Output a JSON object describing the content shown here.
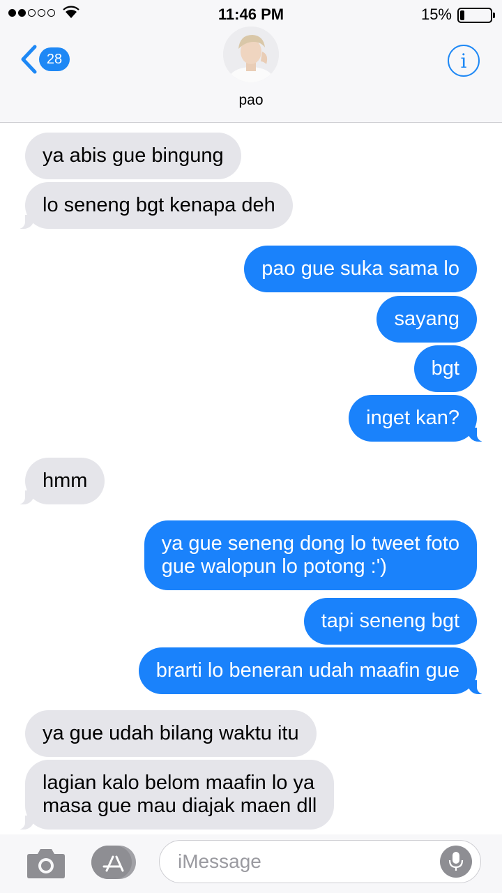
{
  "status_bar": {
    "time": "11:46 PM",
    "battery_percent": "15%",
    "battery_level": 0.15,
    "signal_bars": 2,
    "signal_total": 5
  },
  "header": {
    "back_count": "28",
    "contact_name": "pao",
    "info_icon": "info-icon",
    "accent_color": "#1e88f5"
  },
  "messages": [
    {
      "side": "in",
      "text": "ya abis gue bingung"
    },
    {
      "side": "in",
      "text": "lo seneng bgt kenapa deh"
    },
    {
      "side": "out",
      "text": "pao gue suka sama lo"
    },
    {
      "side": "out",
      "text": "sayang"
    },
    {
      "side": "out",
      "text": "bgt"
    },
    {
      "side": "out",
      "text": "inget kan?"
    },
    {
      "side": "in",
      "text": "hmm"
    },
    {
      "side": "out",
      "lines": [
        "ya gue seneng dong lo tweet foto",
        "gue walopun lo potong :')"
      ]
    },
    {
      "side": "out",
      "text": "tapi seneng bgt"
    },
    {
      "side": "out",
      "text": "brarti lo beneran udah maafin gue"
    },
    {
      "side": "in",
      "text": "ya gue udah bilang waktu itu"
    },
    {
      "side": "in",
      "lines": [
        "lagian kalo belom maafin lo ya",
        "masa gue mau diajak maen dll"
      ]
    }
  ],
  "input_bar": {
    "placeholder": "iMessage",
    "camera_icon": "camera-icon",
    "appstore_icon": "app-store-icon",
    "mic_icon": "microphone-icon"
  },
  "colors": {
    "outgoing_bubble": "#1a82fb",
    "incoming_bubble": "#e5e5ea"
  }
}
